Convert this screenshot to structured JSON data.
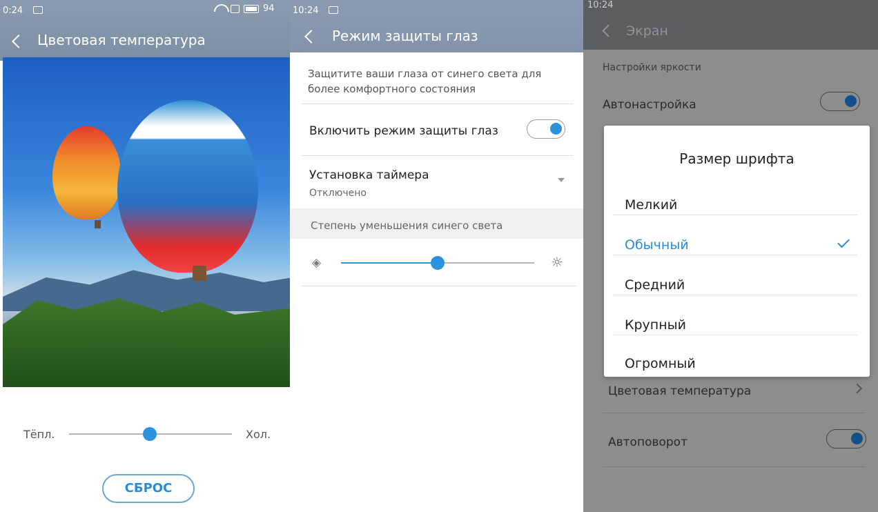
{
  "screens": {
    "color_temperature": {
      "status_time": "0:24",
      "status_battery": "94",
      "title": "Цветовая температура",
      "slider": {
        "left_label": "Тёпл.",
        "right_label": "Хол.",
        "value": 0.5
      },
      "reset_label": "СБРОС"
    },
    "eye_protection": {
      "status_time": "10:24",
      "title": "Режим защиты глаз",
      "description": "Защитите ваши глаза от синего света для более комфортного состояния",
      "enable_label": "Включить режим защиты глаз",
      "enabled": true,
      "timer_label": "Установка таймера",
      "timer_value": "Отключено",
      "reduction_label": "Степень уменьшения синего света",
      "reduction_level": 0.5
    },
    "display": {
      "status_time": "10:24",
      "title": "Экран",
      "section_brightness": "Настройки яркости",
      "auto_brightness_label": "Автонастройка",
      "auto_brightness": true,
      "color_temp_label": "Цветовая температура",
      "auto_rotate_label": "Автоповорот",
      "auto_rotate": true,
      "font_dialog": {
        "title": "Размер шрифта",
        "options": [
          "Мелкий",
          "Обычный",
          "Средний",
          "Крупный",
          "Огромный"
        ],
        "selected": "Обычный"
      }
    }
  },
  "colors": {
    "accent": "#2b93dd",
    "header": "#8394aa"
  },
  "icons": [
    "back-arrow-icon",
    "wifi-icon",
    "sim-icon",
    "battery-icon",
    "image-icon",
    "dropdown-arrow-icon",
    "sun-dim-icon",
    "sun-bright-icon",
    "check-icon",
    "chevron-right-icon"
  ]
}
